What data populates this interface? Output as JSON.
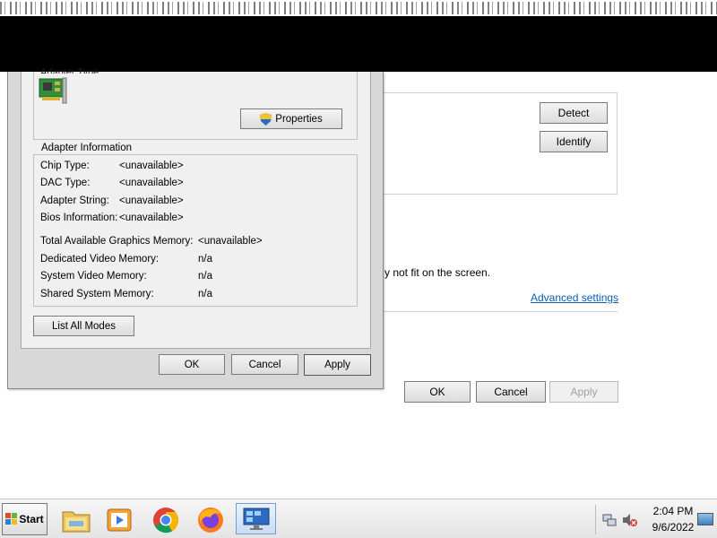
{
  "background_window": {
    "detect_label": "Detect",
    "identify_label": "Identify",
    "fit_text": "y not fit on the screen.",
    "advanced_settings_link": "Advanced settings",
    "ok_label": "OK",
    "cancel_label": "Cancel",
    "apply_label": "Apply"
  },
  "dialog": {
    "adapter_type_label": "Adapter Type",
    "properties_label": "Properties",
    "adapter_info_title": "Adapter Information",
    "rows": [
      {
        "label": "Chip Type:",
        "value": "<unavailable>"
      },
      {
        "label": "DAC Type:",
        "value": "<unavailable>"
      },
      {
        "label": "Adapter String:",
        "value": "<unavailable>"
      },
      {
        "label": "Bios Information:",
        "value": "<unavailable>"
      },
      {
        "label": "Total Available Graphics Memory:",
        "value": "<unavailable>"
      },
      {
        "label": "Dedicated Video Memory:",
        "value": "n/a"
      },
      {
        "label": "System Video Memory:",
        "value": "n/a"
      },
      {
        "label": "Shared System Memory:",
        "value": "n/a"
      }
    ],
    "list_all_modes_label": "List All Modes",
    "ok_label": "OK",
    "cancel_label": "Cancel",
    "apply_label": "Apply"
  },
  "taskbar": {
    "start_label": "Start",
    "icons": [
      "windows-explorer-icon",
      "media-player-icon",
      "chrome-icon",
      "firefox-icon",
      "display-settings-icon"
    ],
    "time": "2:04 PM",
    "date": "9/6/2022"
  },
  "colors": {
    "link": "#0a5fb4",
    "dialog_bg": "#f0f0f0",
    "black_bar": "#000000"
  }
}
